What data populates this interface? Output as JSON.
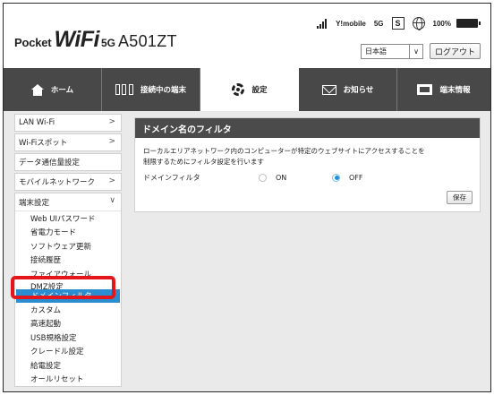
{
  "header": {
    "brand_pocket": "Pocket",
    "brand_wifi": "WiFi",
    "brand_5g": "5G",
    "model": "A501ZT",
    "status": {
      "carrier": "Y!mobile",
      "network": "5G",
      "sim_label": "S",
      "battery": "100%"
    },
    "language": "日本語",
    "logout_label": "ログアウト"
  },
  "nav": {
    "tabs": [
      {
        "label": "ホーム",
        "icon": "home-icon"
      },
      {
        "label": "接続中の端末",
        "icon": "devices-icon"
      },
      {
        "label": "設定",
        "icon": "gear-icon"
      },
      {
        "label": "お知らせ",
        "icon": "mail-icon"
      },
      {
        "label": "端末情報",
        "icon": "device-info-icon"
      }
    ],
    "active": "設定"
  },
  "sidebar": {
    "items": [
      {
        "label": "LAN Wi-Fi",
        "chevron": ">"
      },
      {
        "label": "Wi-Fiスポット",
        "chevron": ">"
      },
      {
        "label": "データ通信量設定"
      },
      {
        "label": "モバイルネットワーク",
        "chevron": ">"
      }
    ],
    "section": {
      "label": "端末設定",
      "chevron": "∨",
      "subitems": [
        "Web UIパスワード",
        "省電力モード",
        "ソフトウェア更新",
        "接続履歴",
        "ファイアウォール",
        "DMZ設定",
        "ドメインフィルタ",
        "カスタム",
        "高速起動",
        "USB規格設定",
        "クレードル設定",
        "給電設定",
        "オールリセット"
      ],
      "selected": "ドメインフィルタ"
    }
  },
  "main": {
    "title": "ドメイン名のフィルタ",
    "description_line1": "ローカルエリアネットワーク内のコンピューターが特定のウェブサイトにアクセスすることを",
    "description_line2": "制限するためにフィルタ設定を行います",
    "filter_label": "ドメインフィルタ",
    "option_on": "ON",
    "option_off": "OFF",
    "selected_option": "OFF",
    "save_label": "保存"
  },
  "colors": {
    "nav_bg": "#484848",
    "selected_blue": "#2b8ccf",
    "highlight_red": "#e4161b",
    "radio_blue": "#1e8fe0"
  }
}
